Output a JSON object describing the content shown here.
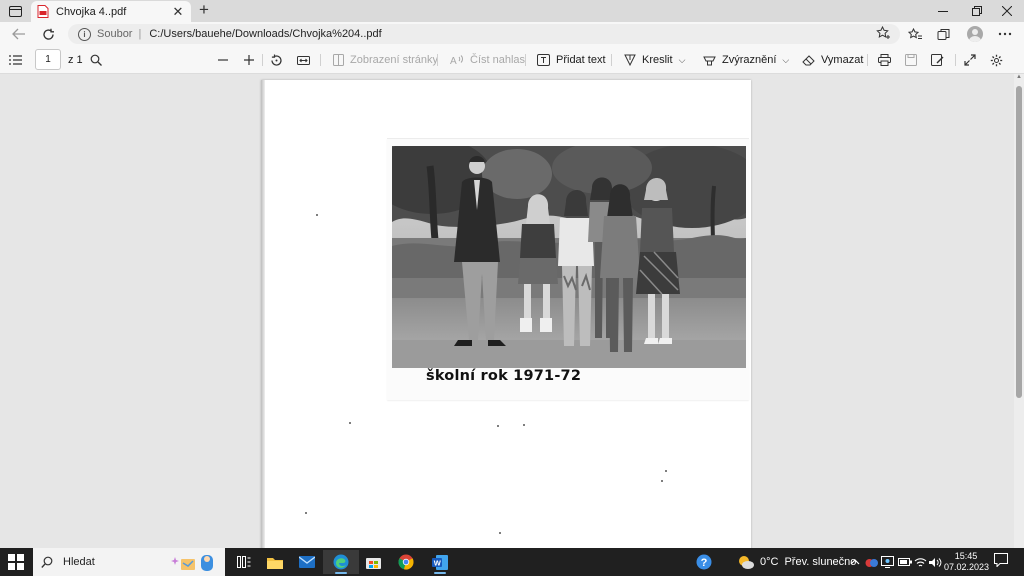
{
  "browser": {
    "tab": {
      "title": "Chvojka 4..pdf"
    },
    "address": {
      "scheme_label": "Soubor",
      "separator": "|",
      "url": "C:/Users/bauehe/Downloads/Chvojka%204..pdf"
    }
  },
  "pdf_toolbar": {
    "page_number": "1",
    "page_total": "z 1",
    "page_view_label": "Zobrazení stránky",
    "read_aloud_label": "Číst nahlas",
    "add_text_label": "Přidat text",
    "draw_label": "Kreslit",
    "highlight_label": "Zvýraznění",
    "erase_label": "Vymazat"
  },
  "document": {
    "caption": "školní rok 1971-72"
  },
  "taskbar": {
    "search_placeholder": "Hledat",
    "weather_temp": "0°C",
    "weather_text": "Přev. slunečno",
    "time": "15:45",
    "date": "07.02.2023"
  },
  "colors": {
    "accent": "#0078d4",
    "taskbar": "#202020",
    "pdf_icon": "#d9262c"
  }
}
